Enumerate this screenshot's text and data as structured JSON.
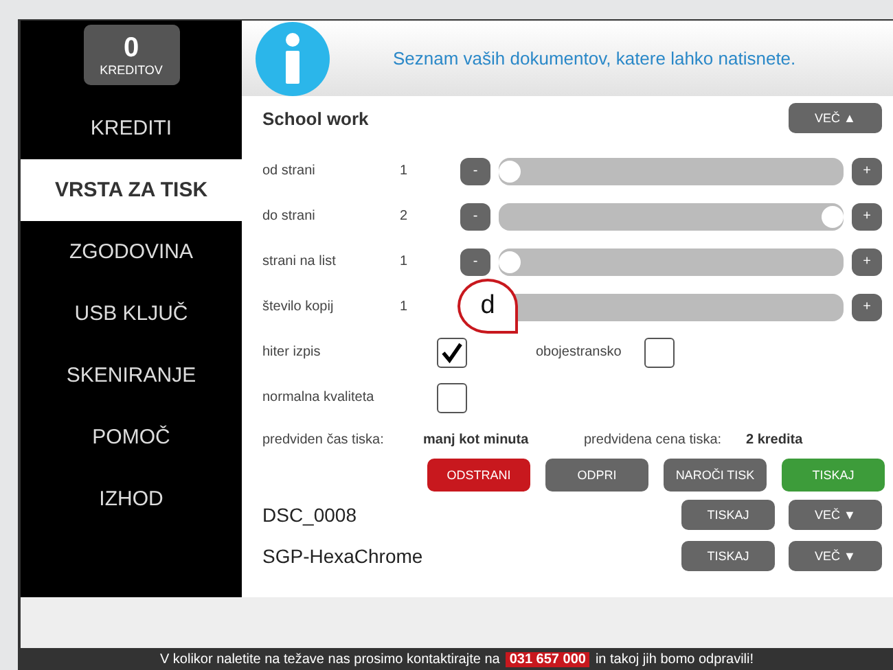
{
  "credits": {
    "count": "0",
    "label": "KREDITOV"
  },
  "nav": [
    {
      "label": "KREDITI",
      "selected": false
    },
    {
      "label": "VRSTA ZA TISK",
      "selected": true
    },
    {
      "label": "ZGODOVINA",
      "selected": false
    },
    {
      "label": "USB KLJUČ",
      "selected": false
    },
    {
      "label": "SKENIRANJE",
      "selected": false
    },
    {
      "label": "POMOČ",
      "selected": false
    },
    {
      "label": "IZHOD",
      "selected": false
    }
  ],
  "header": {
    "message": "Seznam vaših dokumentov, katere lahko natisnete."
  },
  "document": {
    "title": "School work",
    "more_button": "VEČ ▲",
    "settings": [
      {
        "label": "od strani",
        "value": "1",
        "minus": "-",
        "plus": "+",
        "level": 0
      },
      {
        "label": "do strani",
        "value": "2",
        "minus": "-",
        "plus": "+",
        "level": 1
      },
      {
        "label": "strani na list",
        "value": "1",
        "minus": "-",
        "plus": "+",
        "level": 0
      },
      {
        "label": "število kopij",
        "value": "1",
        "plus": "+"
      }
    ],
    "options": [
      {
        "label": "hiter izpis",
        "checked": true
      },
      {
        "label": "obojestransko",
        "checked": false
      },
      {
        "label": "normalna kvaliteta",
        "checked": false
      }
    ],
    "estimates": [
      {
        "label": "predviden čas tiska:",
        "value": "manj kot minuta"
      },
      {
        "label": "predvidena cena tiska:",
        "value": "2 kredita"
      }
    ],
    "actions": [
      {
        "label": "ODSTRANI",
        "kind": "danger"
      },
      {
        "label": "ODPRI",
        "kind": "neutral"
      },
      {
        "label": "NAROČI TISK",
        "kind": "neutral"
      },
      {
        "label": "TISKAJ",
        "kind": "confirm"
      }
    ]
  },
  "other_documents": [
    {
      "name": "DSC_0008",
      "print_button": "TISKAJ",
      "more_button": "VEČ ▼"
    },
    {
      "name": "SGP-HexaChrome",
      "print_button": "TISKAJ",
      "more_button": "VEČ ▼"
    }
  ],
  "callout": {
    "label": "d"
  },
  "footer": {
    "text": "V kolikor naletite na težave nas prosimo kontaktirajte na",
    "phone": "031 657 000",
    "text_after": "in takoj jih bomo odpravili!"
  }
}
